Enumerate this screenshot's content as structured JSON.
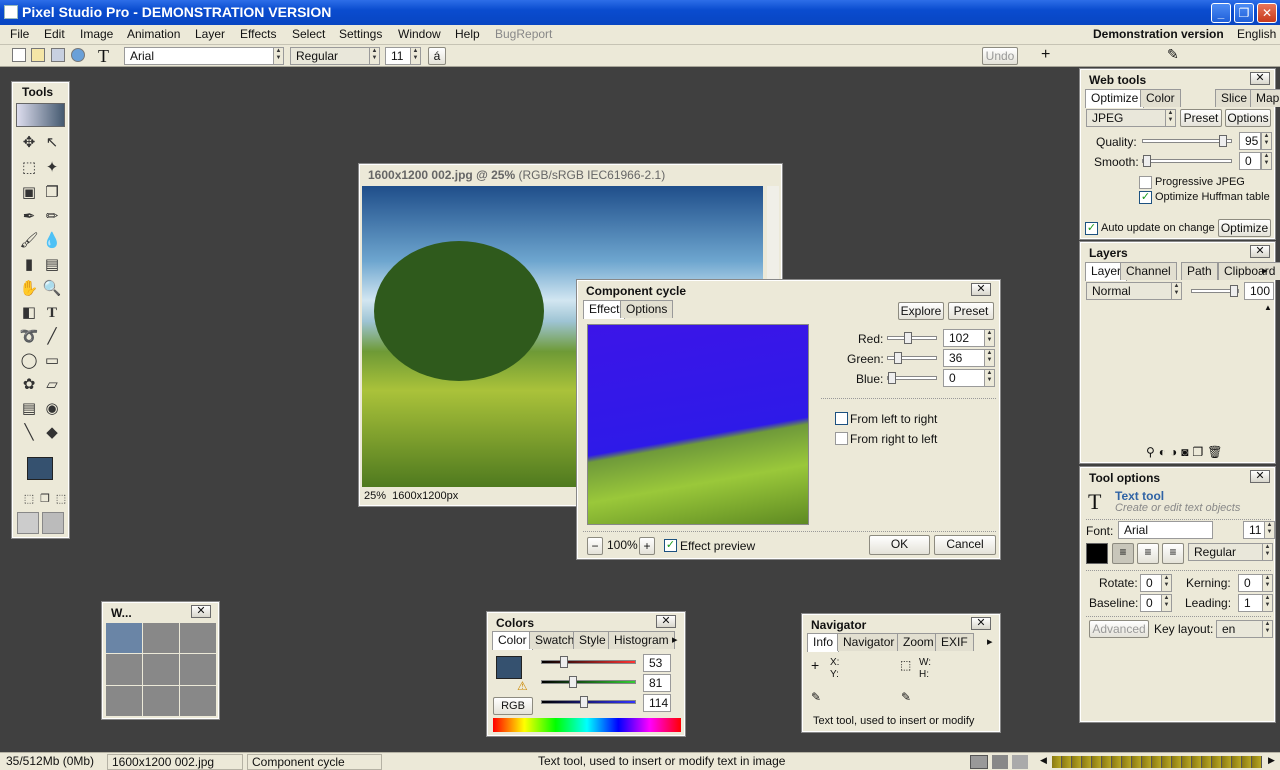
{
  "window": {
    "title": "Pixel Studio Pro - DEMONSTRATION VERSION"
  },
  "menu": {
    "items": [
      "File",
      "Edit",
      "Image",
      "Animation",
      "Layer",
      "Effects",
      "Select",
      "Settings",
      "Window",
      "Help",
      "BugReport"
    ],
    "demo_label": "Demonstration version",
    "language": "English"
  },
  "toolbar": {
    "font": "Arial",
    "style": "Regular",
    "size": "11",
    "char": "á",
    "undo": "Undo"
  },
  "tools_panel": {
    "title": "Tools"
  },
  "image_window": {
    "title": "1600x1200 002.jpg @ 25%",
    "profile": "(RGB/sRGB IEC61966-2.1)",
    "status_zoom": "25%",
    "status_size": "1600x1200px"
  },
  "dialog": {
    "title": "Component cycle",
    "tabs": [
      "Effect",
      "Options"
    ],
    "explore": "Explore",
    "preset": "Preset",
    "red_label": "Red:",
    "red": "102",
    "green_label": "Green:",
    "green": "36",
    "blue_label": "Blue:",
    "blue": "0",
    "red_level": 0.4,
    "green_level": 0.14,
    "blue_level": 0.0,
    "from_left": "From left to right",
    "from_right": "From right to left",
    "zoom": "100%",
    "effect_preview": "Effect preview",
    "ok": "OK",
    "cancel": "Cancel"
  },
  "web_tools": {
    "title": "Web tools",
    "tabs": [
      "Optimize",
      "Color table",
      "Slice",
      "Map"
    ],
    "format": "JPEG",
    "preset": "Preset",
    "options": "Options",
    "quality_label": "Quality:",
    "quality": "95",
    "smooth_label": "Smooth:",
    "smooth": "0",
    "progressive": "Progressive JPEG",
    "huffman": "Optimize Huffman table",
    "auto_update": "Auto update on change",
    "optimize": "Optimize"
  },
  "layers": {
    "title": "Layers",
    "tabs": [
      "Layer",
      "Channel",
      "Path",
      "Clipboard"
    ],
    "blend": "Normal",
    "opacity": "100"
  },
  "tool_options": {
    "title": "Tool options",
    "tool_name": "Text tool",
    "tool_desc": "Create or edit text objects",
    "font_label": "Font:",
    "font": "Arial",
    "size": "11",
    "style": "Regular",
    "rotate_label": "Rotate:",
    "rotate": "0",
    "kerning_label": "Kerning:",
    "kerning": "0",
    "baseline_label": "Baseline:",
    "baseline": "0",
    "leading_label": "Leading:",
    "leading": "1",
    "advanced": "Advanced",
    "keylayout_label": "Key layout:",
    "keylayout": "en"
  },
  "windows_panel": {
    "title": "W..."
  },
  "colors": {
    "title": "Colors",
    "tabs": [
      "Color",
      "Swatch",
      "Style",
      "Histogram"
    ],
    "r": "53",
    "g": "81",
    "b": "114",
    "mode": "RGB",
    "fg": "#35516f"
  },
  "navigator": {
    "title": "Navigator",
    "tabs": [
      "Info",
      "Navigator",
      "Zoom",
      "EXIF"
    ],
    "x": "X:",
    "y": "Y:",
    "w": "W:",
    "h": "H:",
    "hint": "Text tool, used to insert or modify"
  },
  "status": {
    "memory": "35/512Mb (0Mb)",
    "file": "1600x1200 002.jpg",
    "effect": "Component cycle",
    "hint": "Text tool, used to insert or modify text in image"
  }
}
